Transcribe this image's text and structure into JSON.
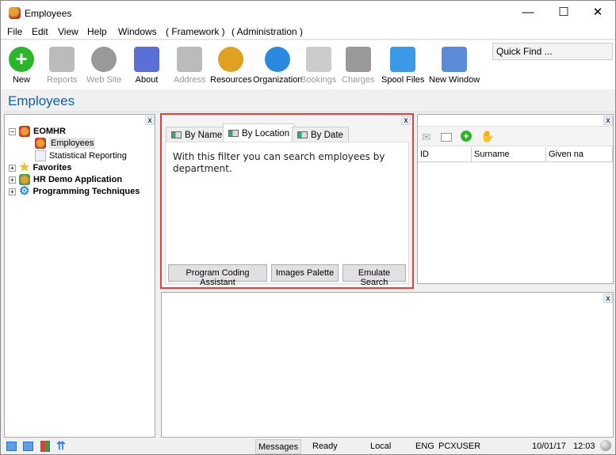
{
  "window": {
    "title": "Employees",
    "controls": [
      "—",
      "☐",
      "✕"
    ]
  },
  "menu": [
    "File",
    "Edit",
    "View",
    "Help",
    "Windows",
    "( Framework )",
    "( Administration )"
  ],
  "toolbar": [
    {
      "label": "New",
      "icon": "plus-circle-icon",
      "enabled": true,
      "color": "#2bb52b"
    },
    {
      "label": "Reports",
      "icon": "folder-icon",
      "enabled": false,
      "color": "#bbbbbb"
    },
    {
      "label": "Web Site",
      "icon": "globe-icon",
      "enabled": false,
      "color": "#999999"
    },
    {
      "label": "About",
      "icon": "gear-window-icon",
      "enabled": true,
      "color": "#5a6fd8"
    },
    {
      "label": "Address",
      "icon": "envelope-icon",
      "enabled": false,
      "color": "#bbbbbb"
    },
    {
      "label": "Resources",
      "icon": "person-icon",
      "enabled": true,
      "color": "#e0a020"
    },
    {
      "label": "Organization",
      "icon": "gear-icon",
      "enabled": true,
      "color": "#2a8ae0"
    },
    {
      "label": "Bookings",
      "icon": "clock-icon",
      "enabled": false,
      "color": "#cccccc"
    },
    {
      "label": "Charges",
      "icon": "database-icon",
      "enabled": false,
      "color": "#999999"
    },
    {
      "label": "Spool Files",
      "icon": "document-icon",
      "enabled": true,
      "color": "#3a9ae8"
    },
    {
      "label": "New Window",
      "icon": "link-window-icon",
      "enabled": true,
      "color": "#5a8ad8"
    }
  ],
  "quick_find": "Quick Find ...",
  "heading": "Employees",
  "tree": {
    "root": "EOMHR",
    "children": [
      "Employees",
      "Statistical Reporting"
    ],
    "others": [
      "Favorites",
      "HR Demo Application",
      "Programming Techniques"
    ]
  },
  "filter": {
    "tabs": [
      "By Name",
      "By Location",
      "By Date"
    ],
    "active_tab": 1,
    "description": "With this filter you can search employees by department.",
    "buttons": [
      "Program Coding Assistant",
      "Images Palette",
      "Emulate Search"
    ]
  },
  "results": {
    "columns": [
      "ID",
      "Surname",
      "Given na"
    ]
  },
  "close_label": "x",
  "status": {
    "messages": "Messages",
    "state": "Ready",
    "location": "Local",
    "lang": "ENG",
    "user": "PCXUSER",
    "date": "10/01/17",
    "time": "12:03"
  }
}
